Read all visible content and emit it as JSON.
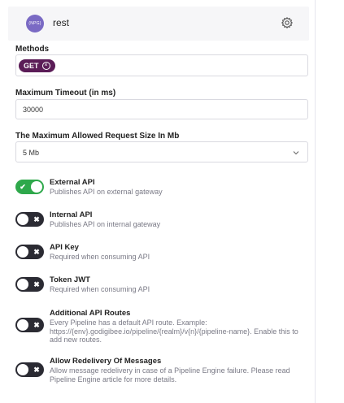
{
  "header": {
    "avatar_text": "(NPG)",
    "title": "rest"
  },
  "methods": {
    "label": "Methods",
    "chip_label": "GET",
    "chip_close": "×"
  },
  "timeout": {
    "label": "Maximum Timeout (in ms)",
    "value": "30000"
  },
  "request_size": {
    "label": "The Maximum Allowed Request Size In Mb",
    "value": "5 Mb"
  },
  "toggles": [
    {
      "title": "External API",
      "description": "Publishes API on external gateway",
      "state": "on",
      "glyph": "✔"
    },
    {
      "title": "Internal API",
      "description": "Publishes API on internal gateway",
      "state": "off",
      "glyph": "✖"
    },
    {
      "title": "API Key",
      "description": "Required when consuming API",
      "state": "off",
      "glyph": "✖"
    },
    {
      "title": "Token JWT",
      "description": "Required when consuming API",
      "state": "off",
      "glyph": "✖"
    },
    {
      "title": "Additional API Routes",
      "description": "Every Pipeline has a default API route. Example: https://{env}.godigibee.io/pipeline/{realm}/v{n}/{pipeline-name}. Enable this to add new routes.",
      "state": "off",
      "glyph": "✖"
    },
    {
      "title": "Allow Redelivery Of Messages",
      "description": "Allow message redelivery in case of a Pipeline Engine failure. Please read Pipeline Engine article for more details.",
      "state": "off",
      "glyph": "✖"
    }
  ],
  "colors": {
    "switch_on": "#2ea84b",
    "switch_off": "#2b2b33",
    "chip": "#5b1c57",
    "avatar": "#7a6ac4"
  },
  "icons": {
    "settings": "gear-icon",
    "dropdown": "chevron-down-icon"
  }
}
